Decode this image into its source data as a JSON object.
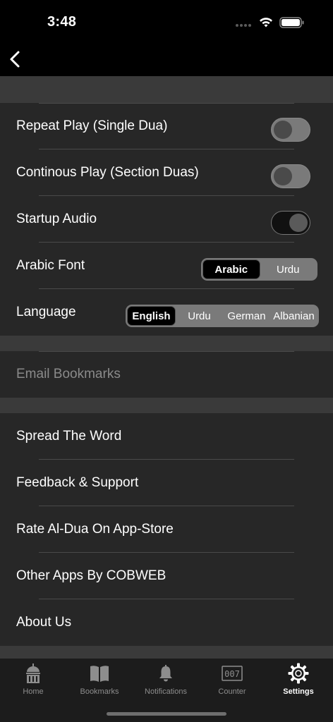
{
  "status": {
    "time": "3:48"
  },
  "settings": {
    "repeat_play": {
      "label": "Repeat Play (Single Dua)",
      "on": false
    },
    "continous_play": {
      "label": "Continous Play (Section Duas)",
      "on": false
    },
    "startup_audio": {
      "label": "Startup Audio",
      "on": true
    },
    "arabic_font": {
      "label": "Arabic Font",
      "options": [
        "Arabic",
        "Urdu"
      ],
      "selected": "Arabic"
    },
    "language": {
      "label": "Language",
      "options": [
        "English",
        "Urdu",
        "German",
        "Albanian"
      ],
      "selected": "English"
    }
  },
  "email_bookmarks": {
    "label": "Email Bookmarks"
  },
  "links": [
    {
      "label": "Spread The Word"
    },
    {
      "label": "Feedback & Support"
    },
    {
      "label": "Rate Al-Dua On App-Store"
    },
    {
      "label": "Other Apps By COBWEB"
    },
    {
      "label": "About Us"
    }
  ],
  "tabs": [
    {
      "label": "Home",
      "icon": "mosque-icon"
    },
    {
      "label": "Bookmarks",
      "icon": "book-icon"
    },
    {
      "label": "Notifications",
      "icon": "bell-icon"
    },
    {
      "label": "Counter",
      "icon": "counter-icon"
    },
    {
      "label": "Settings",
      "icon": "gear-icon",
      "active": true
    }
  ],
  "colors": {
    "background": "#272727",
    "section_gap": "#3a3a3a",
    "tab_bar": "#1c1c1c",
    "accent": "#ffffff"
  }
}
